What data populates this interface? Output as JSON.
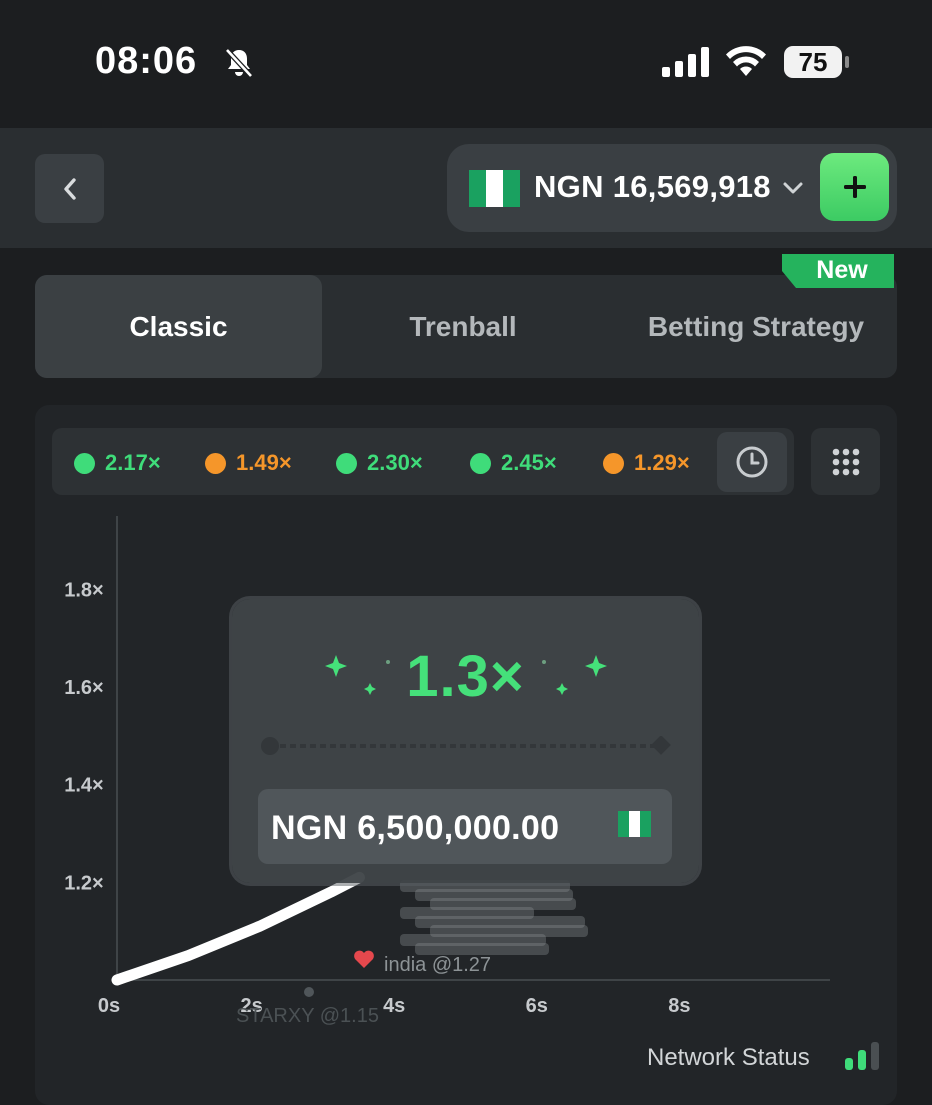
{
  "status_bar": {
    "time": "08:06",
    "battery": "75"
  },
  "header": {
    "balance": "NGN 16,569,918",
    "currency_flag": "nigeria-flag-icon"
  },
  "tabs": {
    "new_badge": "New",
    "items": [
      {
        "label": "Classic",
        "active": true
      },
      {
        "label": "Trenball",
        "active": false
      },
      {
        "label": "Betting Strategy",
        "active": false
      }
    ]
  },
  "history": [
    {
      "value": "2.17×",
      "color": "#3fdc7a"
    },
    {
      "value": "1.49×",
      "color": "#f5962a"
    },
    {
      "value": "2.30×",
      "color": "#3fdc7a"
    },
    {
      "value": "2.45×",
      "color": "#3fdc7a"
    },
    {
      "value": "1.29×",
      "color": "#f5962a"
    }
  ],
  "chart_data": {
    "type": "line",
    "x_ticks": [
      "0s",
      "2s",
      "4s",
      "6s",
      "8s"
    ],
    "y_ticks": [
      "1.2×",
      "1.4×",
      "1.6×",
      "1.8×"
    ],
    "xlim": [
      0,
      10
    ],
    "ylim": [
      1.0,
      1.95
    ],
    "series": [
      {
        "x": [
          0,
          1,
          2,
          3,
          3.4
        ],
        "y": [
          1.0,
          1.05,
          1.11,
          1.18,
          1.21
        ]
      }
    ],
    "player_labels": [
      "india @1.27",
      "STARXY @1.15"
    ]
  },
  "result": {
    "multiplier": "1.3×",
    "payout": "NGN 6,500,000.00"
  },
  "network": {
    "label": "Network Status"
  },
  "colors": {
    "accent_green": "#3fdc7a",
    "orange": "#f5962a",
    "background": "#1c1e20"
  }
}
